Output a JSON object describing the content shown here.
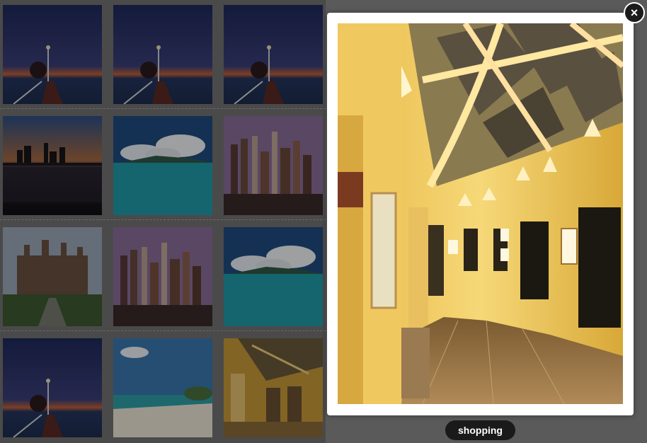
{
  "gallery": {
    "thumbnails": [
      {
        "scene": "pier-sunset"
      },
      {
        "scene": "pier-sunset"
      },
      {
        "scene": "pier-sunset"
      },
      {
        "scene": "skyline-night"
      },
      {
        "scene": "island-ocean"
      },
      {
        "scene": "city-towers"
      },
      {
        "scene": "castle"
      },
      {
        "scene": "city-towers"
      },
      {
        "scene": "island-ocean"
      },
      {
        "scene": "pier-sunset"
      },
      {
        "scene": "beach"
      },
      {
        "scene": "corridor"
      }
    ]
  },
  "lightbox": {
    "caption": "shopping",
    "close_icon": "close-icon",
    "image_scene": "yellow-lit-curved-corridor"
  }
}
